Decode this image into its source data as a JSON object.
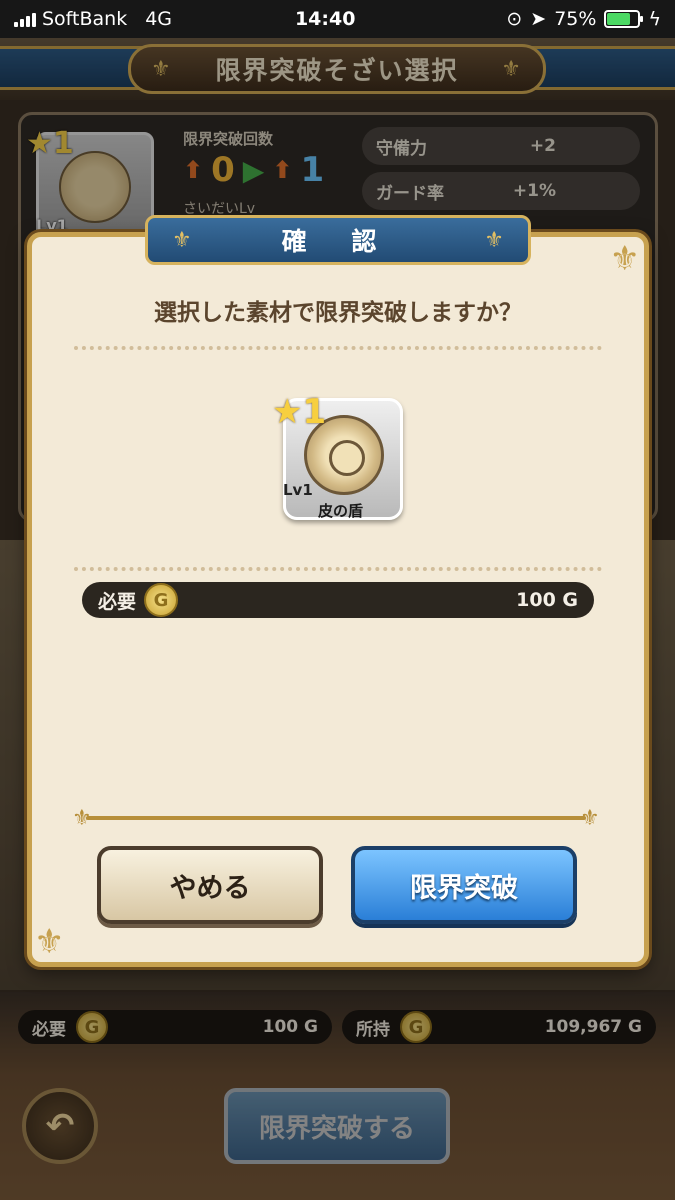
{
  "status_bar": {
    "carrier": "SoftBank",
    "network": "4G",
    "time": "14:40",
    "battery": "75%",
    "battery_level": 0.75,
    "battery_color": "#4cd964"
  },
  "screen": {
    "title": "限界突破そざい選択"
  },
  "background_card": {
    "rarity": "1",
    "level": "Lv1",
    "limit_break_label": "限界突破回数",
    "limit_from": "0",
    "limit_to": "1",
    "cut_text": "さいだいLv",
    "stats": [
      {
        "label": "守備力",
        "value": "+2"
      },
      {
        "label": "ガード率",
        "value": "+1%"
      }
    ]
  },
  "dialog": {
    "title": "確 認",
    "message": "選択した素材で限界突破しますか？",
    "item": {
      "rarity": "1",
      "level": "Lv1",
      "name": "皮の盾",
      "icon": "leather-shield-icon"
    },
    "required_label": "必要",
    "required_amount": "100 G",
    "coin_glyph": "G",
    "cancel_label": "やめる",
    "confirm_label": "限界突破"
  },
  "footer": {
    "required_label": "必要",
    "required_amount": "100 G",
    "owned_label": "所持",
    "owned_amount": "109,967 G",
    "coin_glyph": "G",
    "main_button": "限界突破する",
    "back_icon": "back-arrow-icon"
  },
  "colors": {
    "accent_gold": "#c7a14f",
    "confirm_blue": "#2a7fd7",
    "dialog_bg": "#f3ead7"
  }
}
